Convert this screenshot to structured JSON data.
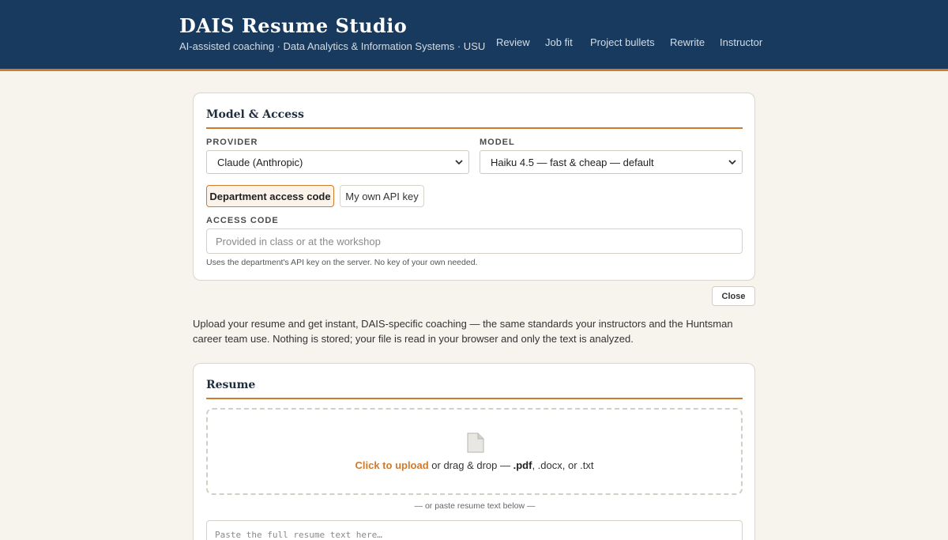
{
  "header": {
    "title": "DAIS Resume Studio",
    "subtitle": "AI-assisted coaching · Data Analytics & Information Systems · USU",
    "nav": [
      "Review",
      "Job fit",
      "Project bullets",
      "Rewrite",
      "Instructor"
    ]
  },
  "model_access": {
    "title": "Model & Access",
    "provider_label": "PROVIDER",
    "provider_value": "Claude (Anthropic)",
    "model_label": "MODEL",
    "model_value": "Haiku 4.5 — fast & cheap — default",
    "tabs": [
      "Department access code",
      "My own API key"
    ],
    "access_code_label": "ACCESS CODE",
    "access_code_placeholder": "Provided in class or at the workshop",
    "help_text": "Uses the department's API key on the server. No key of your own needed."
  },
  "close_label": "Close",
  "intro_text": "Upload your resume and get instant, DAIS-specific coaching — the same standards your instructors and the Huntsman career team use. Nothing is stored; your file is read in your browser and only the text is analyzed.",
  "resume": {
    "title": "Resume",
    "upload_link": "Click to upload",
    "upload_middle": " or drag & drop — ",
    "ext_pdf": ".pdf",
    "upload_tail": ", .docx, or .txt",
    "or_paste": "— or paste resume text below —",
    "textarea_placeholder": "Paste the full resume text here…"
  },
  "colors": {
    "header_bg": "#173a5e",
    "accent": "#d07a2d",
    "page_bg": "#f7f4ee"
  },
  "icons": [
    "chevron-down-icon",
    "file-icon"
  ]
}
